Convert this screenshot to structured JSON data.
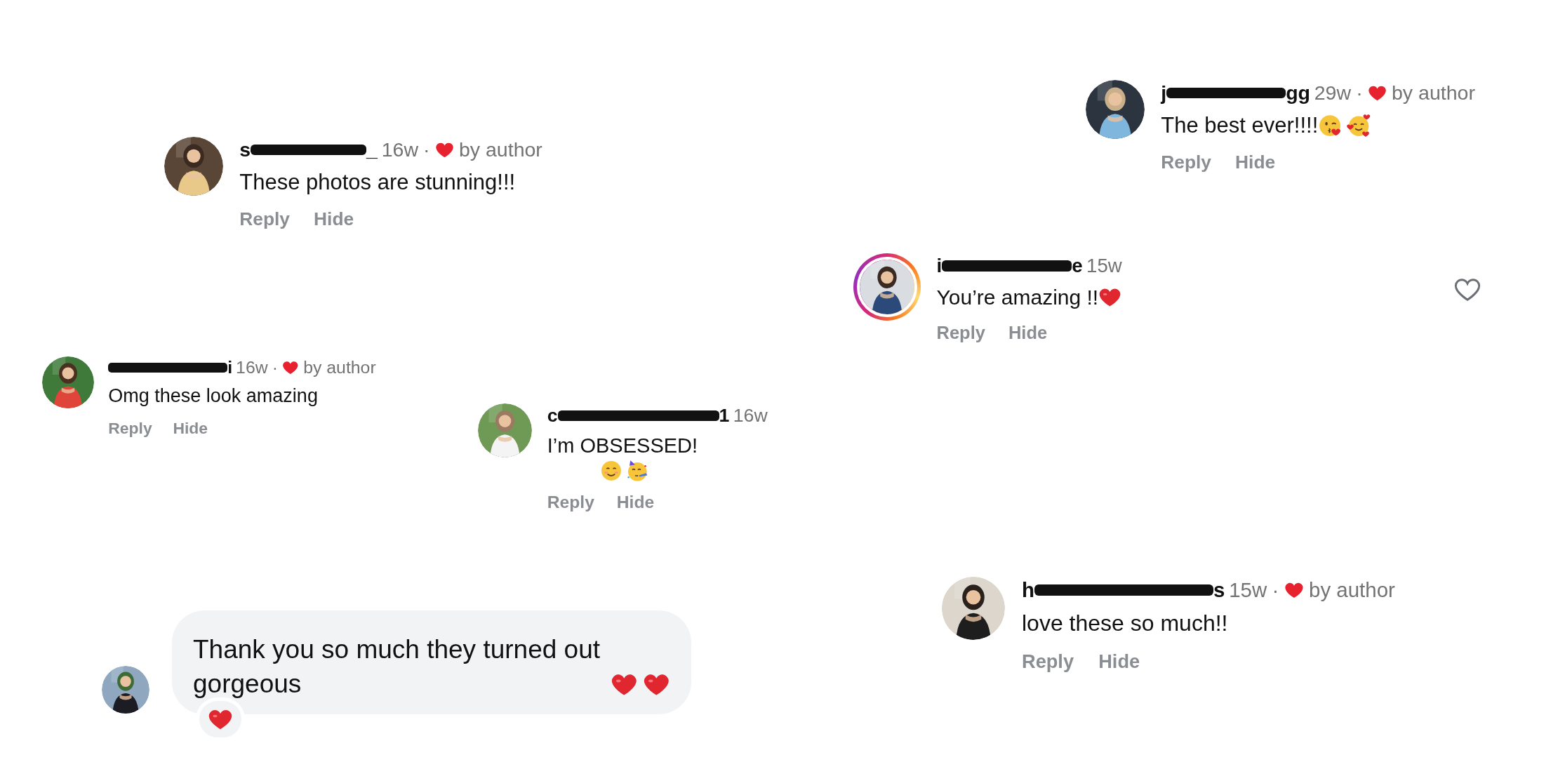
{
  "comments": [
    {
      "kind": "comment",
      "name_start": "s",
      "name_end": "_",
      "time": "16w",
      "dot": "·",
      "like_label": "by author",
      "text": "These photos are stunning!!!",
      "reply": "Reply",
      "hide": "Hide"
    },
    {
      "kind": "comment",
      "name_start": "j",
      "name_end": "gg",
      "time": "29w",
      "dot": "·",
      "like_label": "by author",
      "text": "The best ever!!!!",
      "emojis": [
        {
          "kind": "kiss"
        },
        {
          "kind": "smiling_hearts"
        }
      ],
      "reply": "Reply",
      "hide": "Hide"
    },
    {
      "kind": "comment",
      "story_ring": true,
      "name_start": "i",
      "name_end": "e",
      "time": "15w",
      "text": "You’re amazing !!",
      "emojis": [
        {
          "kind": "heart"
        }
      ],
      "reply": "Reply",
      "hide": "Hide",
      "like_button": {
        "liked": false
      }
    },
    {
      "kind": "comment",
      "name_end": "i",
      "time": "16w",
      "dot": "·",
      "like_label": "by author",
      "text": "Omg these look amazing",
      "reply": "Reply",
      "hide": "Hide"
    },
    {
      "kind": "comment",
      "name_start": "c",
      "name_end": "1",
      "time": "16w",
      "text": "I’m OBSESSED!",
      "emojis": [
        {
          "kind": "smile"
        },
        {
          "kind": "party"
        }
      ],
      "reply": "Reply",
      "hide": "Hide"
    },
    {
      "kind": "bubble",
      "text": "Thank you so much they turned out gorgeous",
      "emojis": [
        {
          "kind": "heart"
        },
        {
          "kind": "heart"
        }
      ],
      "reaction": {
        "kind": "heart"
      }
    },
    {
      "kind": "comment",
      "name_start": "h",
      "name_end": "s",
      "time": "15w",
      "dot": "·",
      "like_label": "by author",
      "text": "love these so much!!",
      "reply": "Reply",
      "hide": "Hide"
    }
  ]
}
